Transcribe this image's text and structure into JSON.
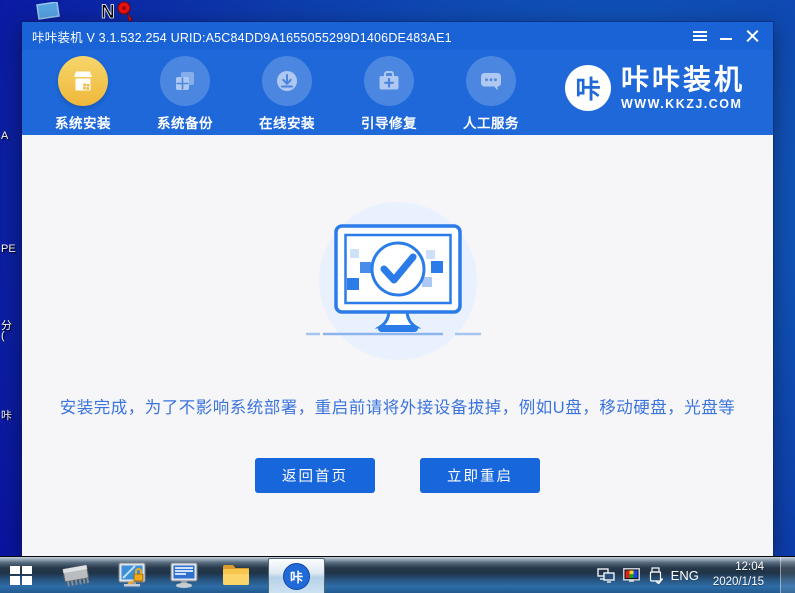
{
  "desktop": {
    "partial_labels": [
      "A",
      "PE",
      "分",
      "(",
      "咔"
    ]
  },
  "window": {
    "titlebar": {
      "title": "咔咔装机 V 3.1.532.254 URID:A5C84DD9A1655055299D1406DE483AE1"
    },
    "nav": {
      "items": [
        {
          "label": "系统安装",
          "active": true
        },
        {
          "label": "系统备份",
          "active": false
        },
        {
          "label": "在线安装",
          "active": false
        },
        {
          "label": "引导修复",
          "active": false
        },
        {
          "label": "人工服务",
          "active": false
        }
      ],
      "logo": {
        "badge": "咔",
        "name": "咔咔装机",
        "site": "WWW.KKZJ.COM"
      }
    },
    "content": {
      "message": "安装完成，为了不影响系统部署，重启前请将外接设备拔掉，例如U盘，移动硬盘，光盘等",
      "buttons": {
        "home": "返回首页",
        "restart": "立即重启"
      }
    }
  },
  "taskbar": {
    "app_badge": "咔",
    "language": "ENG",
    "time": "12:04",
    "date": "2020/1/15"
  },
  "colors": {
    "titlebar_blue": "#1a63d6",
    "nav_blue": "#1e68da",
    "active_gold": "#eeb83a",
    "button_blue": "#1866dc",
    "message_blue": "#3b74dd",
    "content_bg": "#f6f6f8"
  }
}
